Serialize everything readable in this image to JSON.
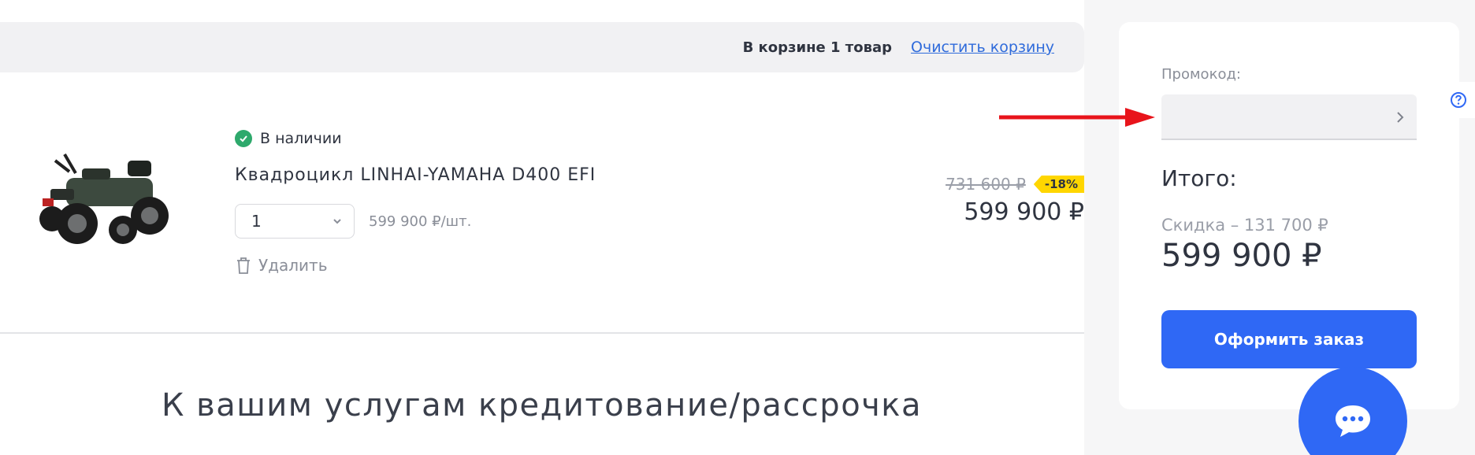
{
  "cart": {
    "count_text": "В корзине 1 товар",
    "clear_link": "Очистить корзину"
  },
  "product": {
    "availability": "В наличии",
    "name": "Квадроцикл LINHAI-YAMAHA D400 EFI",
    "quantity": "1",
    "unit_price": "599 900 ₽/шт.",
    "delete_label": "Удалить",
    "old_price": "731 600 ₽",
    "discount_badge": "-18%",
    "new_price": "599 900 ₽"
  },
  "credit": {
    "heading": "К вашим услугам кредитование/рассрочка"
  },
  "summary": {
    "promo_label": "Промокод:",
    "promo_value": "",
    "total_label": "Итого:",
    "discount_text": "Скидка – 131 700 ₽",
    "total_price": "599 900 ₽",
    "checkout_label": "Оформить заказ"
  },
  "colors": {
    "accent_blue": "#2f68f5",
    "link_blue": "#2f6bdb",
    "in_stock_green": "#2ea96c",
    "discount_yellow": "#ffd600",
    "annotation_red": "#e8141b"
  },
  "icons": {
    "availability": "check-circle-icon",
    "quantity_dropdown": "chevron-down-icon",
    "delete": "trash-icon",
    "promo_submit": "chevron-right-icon",
    "help": "question-circle-icon",
    "chat": "chat-bubble-icon"
  }
}
